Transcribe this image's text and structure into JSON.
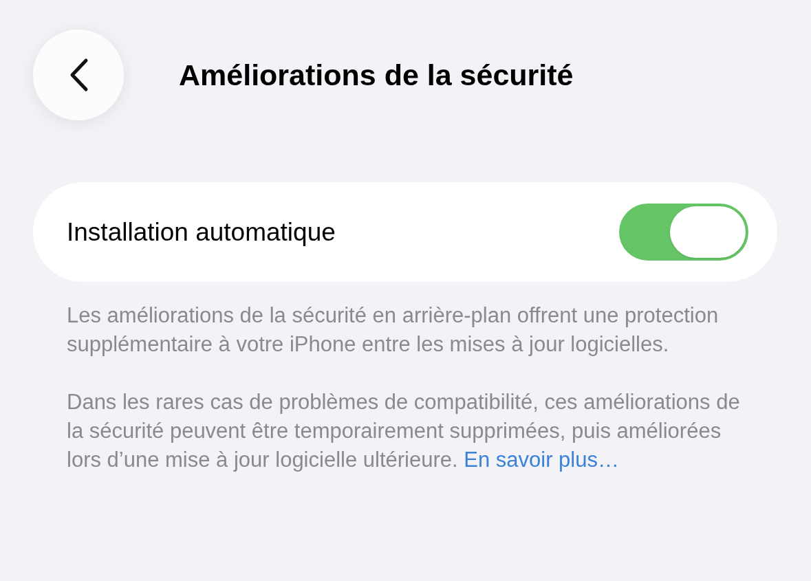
{
  "header": {
    "title": "Améliorations de la sécurité"
  },
  "setting": {
    "label": "Installation automatique",
    "on": true
  },
  "footer": [
    {
      "text": "Les améliorations de la sécurité en arrière-plan offrent une protection supplémentaire à votre iPhone entre les mises à jour logicielles."
    },
    {
      "text": "Dans les rares cas de problèmes de compatibilité, ces améliorations de la sécurité peuvent être temporairement supprimées, puis améliorées lors d’une mise à jour logicielle ultérieure.",
      "link": "En savoir plus…"
    }
  ]
}
